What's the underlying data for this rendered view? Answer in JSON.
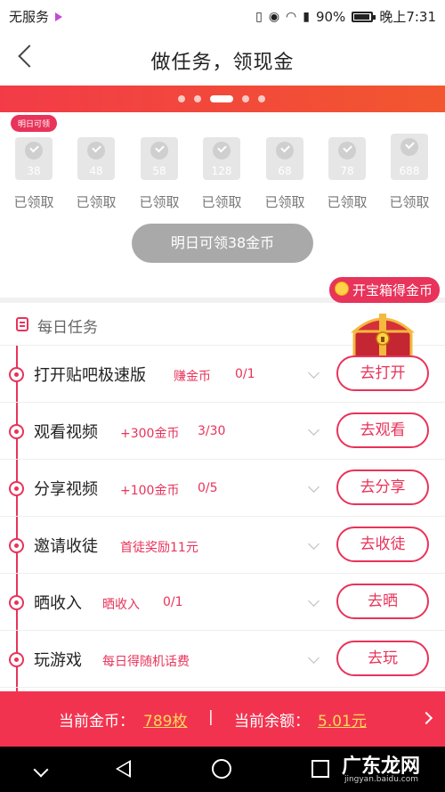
{
  "status_bar": {
    "carrier": "无服务",
    "battery": "90%",
    "time": "晚上7:31"
  },
  "header": {
    "title": "做任务，领现金"
  },
  "checkin": {
    "tomorrow_tag": "明日可领",
    "days": [
      {
        "coins": "38",
        "label": "已领取"
      },
      {
        "coins": "48",
        "label": "已领取"
      },
      {
        "coins": "58",
        "label": "已领取"
      },
      {
        "coins": "128",
        "label": "已领取"
      },
      {
        "coins": "68",
        "label": "已领取"
      },
      {
        "coins": "78",
        "label": "已领取"
      },
      {
        "coins": "688",
        "label": "已领取"
      }
    ],
    "button_label": "明日可领38金币"
  },
  "chest": {
    "badge_label": "开宝箱得金币"
  },
  "daily": {
    "title": "每日任务",
    "tasks": [
      {
        "name": "打开贴吧极速版",
        "reward": "赚金币",
        "progress": "0/1",
        "button": "去打开"
      },
      {
        "name": "观看视频",
        "reward": "+300金币",
        "progress": "3/30",
        "button": "去观看"
      },
      {
        "name": "分享视频",
        "reward": "+100金币",
        "progress": "0/5",
        "button": "去分享"
      },
      {
        "name": "邀请收徒",
        "reward": "首徒奖励11元",
        "progress": "",
        "button": "去收徒"
      },
      {
        "name": "晒收入",
        "reward": "晒收入",
        "progress": "0/1",
        "button": "去晒"
      },
      {
        "name": "玩游戏",
        "reward": "每日得随机话费",
        "progress": "",
        "button": "去玩"
      }
    ]
  },
  "bottom_bar": {
    "coins_label": "当前金币：",
    "coins_value": "789枚",
    "separator": "|",
    "balance_label": "当前余额：",
    "balance_value": "5.01元"
  },
  "watermark": {
    "text": "广东龙网",
    "sub": "jingyan.baidu.com"
  }
}
